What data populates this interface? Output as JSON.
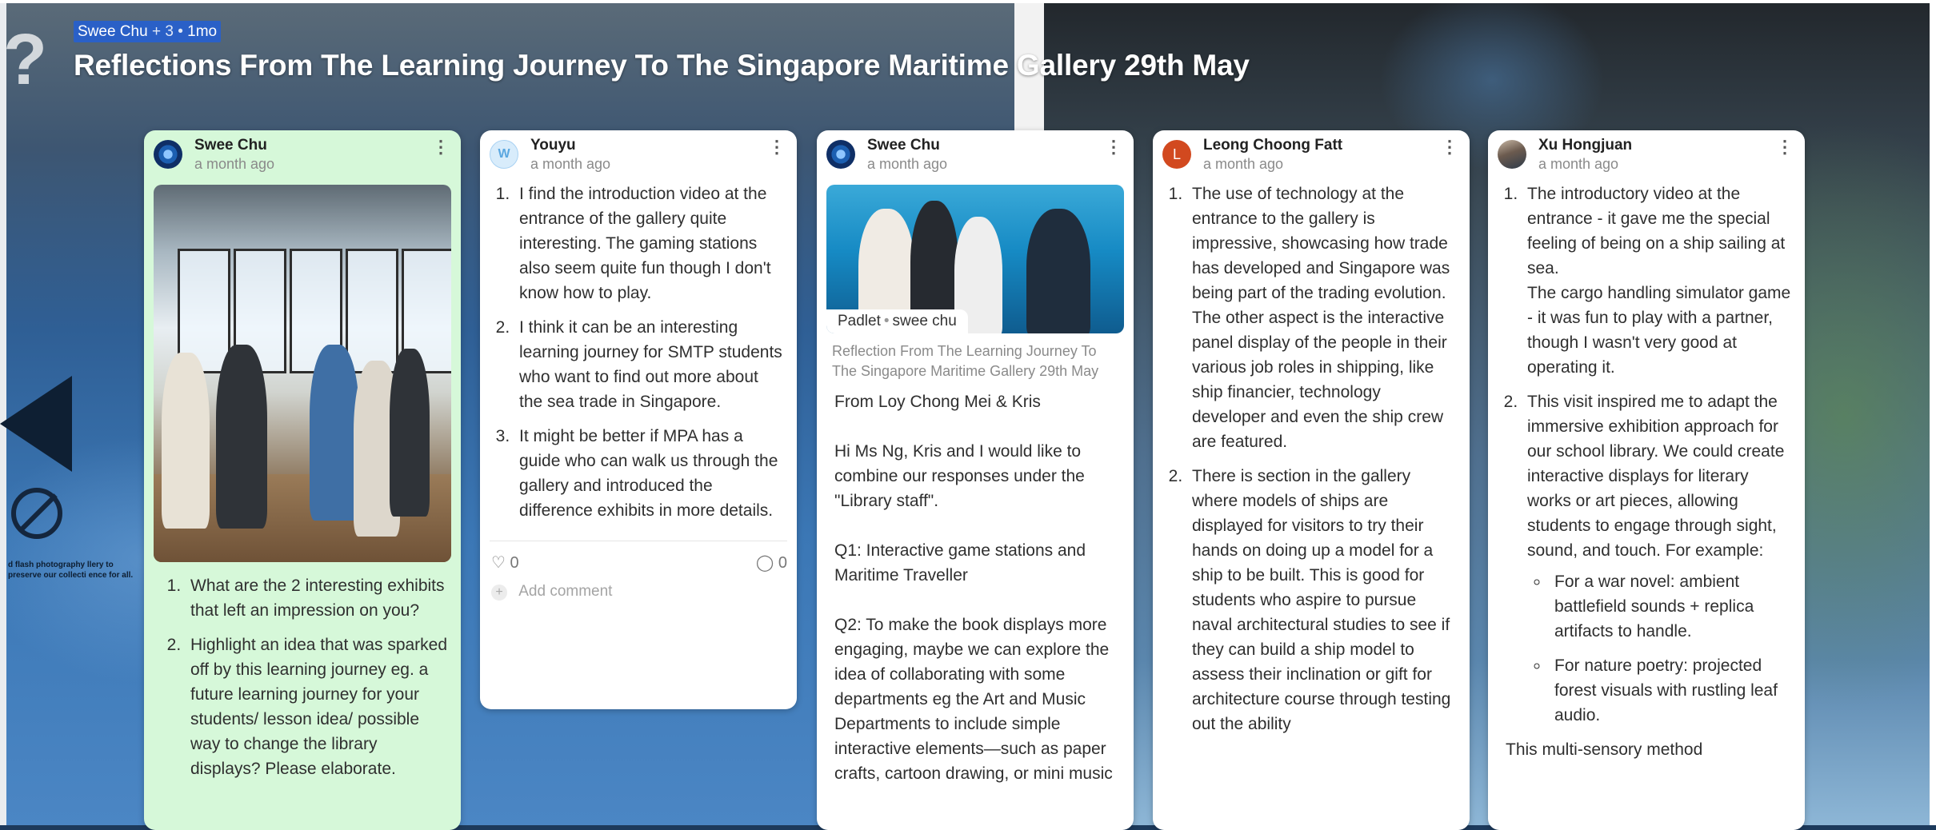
{
  "header": {
    "author": "Swee Chu",
    "plus_count": "+ 3",
    "separator": "•",
    "age": "1mo",
    "title": "Reflections From The Learning Journey To The Singapore Maritime Gallery 29th May"
  },
  "background": {
    "glyph": "?",
    "sign_text": "d flash photography llery to preserve our collecti ence for all."
  },
  "icons": {
    "more": "⋮",
    "like": "♡",
    "comment": "💬",
    "plus": "+"
  },
  "posts": [
    {
      "author": "Swee Chu",
      "time": "a month ago",
      "items": [
        "What are the 2 interesting exhibits that left an impression on you?",
        "Highlight an idea that was sparked off by this learning journey eg. a future learning journey for your students/ lesson idea/ possible way to change the library displays? Please elaborate."
      ]
    },
    {
      "author": "Youyu",
      "time": "a month ago",
      "items": [
        "I find the introduction video at the entrance of the gallery quite interesting. The gaming stations also seem quite fun though I don't know how to play.",
        "I think it can be an interesting learning journey for SMTP students who want to find out more about the sea trade in Singapore.",
        "It might be better if MPA has a guide who can walk us through the gallery and introduced the difference exhibits in more details."
      ],
      "likes": "0",
      "comments": "0",
      "add_comment": "Add comment"
    },
    {
      "author": "Swee Chu",
      "time": "a month ago",
      "attachment_source": "Padlet",
      "attachment_owner": "swee chu",
      "attachment_caption": "Reflection From The Learning Journey To The Singapore Maritime Gallery 29th May",
      "paragraphs": [
        "From Loy Chong Mei & Kris",
        "Hi Ms Ng, Kris and I would like to combine our responses under the \"Library staff\".",
        "Q1: Interactive game stations and Maritime Traveller",
        "Q2: To make the book displays more engaging, maybe we can explore the idea of collaborating with some departments eg  the Art and Music Departments to include simple interactive elements—such as paper crafts, cartoon drawing, or mini music"
      ]
    },
    {
      "author": "Leong Choong Fatt",
      "avatar_letter": "L",
      "time": "a month ago",
      "items": [
        "The use of technology at the entrance to the gallery is impressive, showcasing how trade has developed and Singapore was being part of the trading evolution. The other aspect is the interactive panel display of the people in their various job roles in shipping, like ship financier, technology developer and even the ship crew are featured.",
        "There is section in the gallery where models of ships are displayed for visitors to try their hands on doing up a model for a ship to be built. This is good for students who aspire to pursue naval architectural studies to see if they can build a ship model to assess their inclination or gift for architecture course through testing out the ability"
      ]
    },
    {
      "author": "Xu Hongjuan",
      "time": "a month ago",
      "item1_line1": "The introductory video at the entrance - it gave me the special feeling of being on a ship sailing at sea.",
      "item1_line2": "The cargo handling simulator game - it was fun to play with a partner, though I wasn't very good at operating it.",
      "item2": "This visit inspired me to adapt the immersive exhibition approach for our school library. We could create interactive displays for literary works or art pieces, allowing students to engage through sight, sound, and touch. For example:",
      "bullets": [
        "For a war novel: ambient battlefield sounds + replica artifacts to handle.",
        "For nature poetry: projected forest visuals with rustling leaf audio."
      ],
      "tail": "This multi-sensory method"
    }
  ]
}
